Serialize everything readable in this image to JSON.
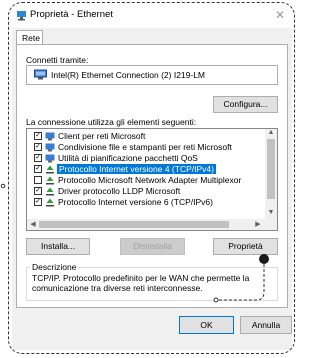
{
  "window": {
    "title": "Proprietà - Ethernet",
    "close_glyph": "✕"
  },
  "tabs": [
    {
      "label": "Rete"
    }
  ],
  "connection": {
    "label": "Connetti tramite:",
    "adapter": "Intel(R) Ethernet Connection (2) I219-LM",
    "configure_label": "Configura..."
  },
  "items_section": {
    "label": "La connessione utilizza gli elementi seguenti:",
    "items": [
      {
        "label": "Client per reti Microsoft",
        "checked": true,
        "icon": "network-client-icon",
        "selected": false
      },
      {
        "label": "Condivisione file e stampanti per reti Microsoft",
        "checked": true,
        "icon": "network-service-icon",
        "selected": false
      },
      {
        "label": "Utilità di pianificazione pacchetti QoS",
        "checked": true,
        "icon": "network-service-icon",
        "selected": false
      },
      {
        "label": "Protocollo Internet versione 4 (TCP/IPv4)",
        "checked": true,
        "icon": "protocol-icon",
        "selected": true
      },
      {
        "label": "Protocollo Microsoft Network Adapter Multiplexor",
        "checked": false,
        "icon": "protocol-icon",
        "selected": false
      },
      {
        "label": "Driver protocollo LLDP Microsoft",
        "checked": true,
        "icon": "protocol-icon",
        "selected": false
      },
      {
        "label": "Protocollo Internet versione 6 (TCP/IPv6)",
        "checked": true,
        "icon": "protocol-icon",
        "selected": false
      }
    ]
  },
  "buttons": {
    "install": "Installa...",
    "uninstall": "Disinstalla",
    "properties": "Proprietà",
    "ok": "OK",
    "cancel": "Annulla"
  },
  "description": {
    "legend": "Descrizione",
    "text": "TCP/IP. Protocollo predefinito per le WAN che permette la comunicazione tra diverse reti interconnesse."
  },
  "colors": {
    "selection": "#0078d7",
    "dialog_bg": "#f0f0f0",
    "panel_bg": "#ffffff"
  }
}
